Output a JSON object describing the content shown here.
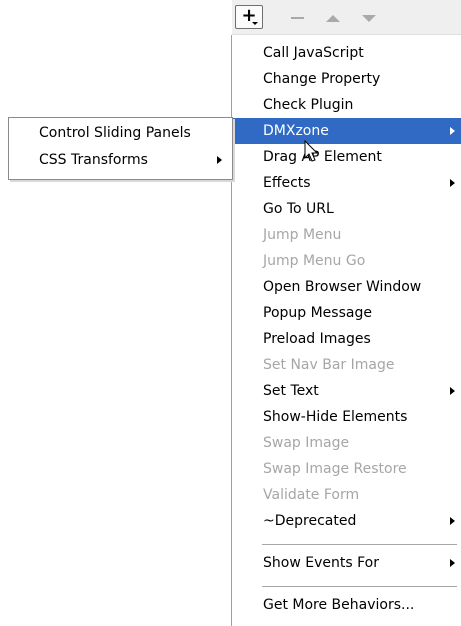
{
  "toolbar": {
    "add": {
      "icon": "plus-icon",
      "label": "+"
    },
    "remove": {
      "icon": "minus-icon",
      "enabled": false
    },
    "move_up": {
      "icon": "arrow-up-icon",
      "enabled": false
    },
    "move_down": {
      "icon": "arrow-down-icon",
      "enabled": false
    }
  },
  "menu": {
    "items": [
      {
        "label": "Call JavaScript",
        "enabled": true
      },
      {
        "label": "Change Property",
        "enabled": true
      },
      {
        "label": "Check Plugin",
        "enabled": true
      },
      {
        "label": "DMXzone",
        "enabled": true,
        "highlighted": true,
        "submenu": true
      },
      {
        "label": "Drag AP Element",
        "enabled": true
      },
      {
        "label": "Effects",
        "enabled": true,
        "submenu": true
      },
      {
        "label": "Go To URL",
        "enabled": true
      },
      {
        "label": "Jump Menu",
        "enabled": false
      },
      {
        "label": "Jump Menu Go",
        "enabled": false
      },
      {
        "label": "Open Browser Window",
        "enabled": true
      },
      {
        "label": "Popup Message",
        "enabled": true
      },
      {
        "label": "Preload Images",
        "enabled": true
      },
      {
        "label": "Set Nav Bar Image",
        "enabled": false
      },
      {
        "label": "Set Text",
        "enabled": true,
        "submenu": true
      },
      {
        "label": "Show-Hide Elements",
        "enabled": true
      },
      {
        "label": "Swap Image",
        "enabled": false
      },
      {
        "label": "Swap Image Restore",
        "enabled": false
      },
      {
        "label": "Validate Form",
        "enabled": false
      },
      {
        "label": "~Deprecated",
        "enabled": true,
        "submenu": true
      },
      {
        "label": "Show Events For",
        "enabled": true,
        "submenu": true
      },
      {
        "label": "Get More Behaviors...",
        "enabled": true
      }
    ]
  },
  "submenu": {
    "items": [
      {
        "label": "Control Sliding Panels",
        "submenu": false
      },
      {
        "label": "CSS Transforms",
        "submenu": true
      }
    ]
  },
  "colors": {
    "highlight": "#316ac5",
    "disabled_text": "#a6a6a6"
  }
}
